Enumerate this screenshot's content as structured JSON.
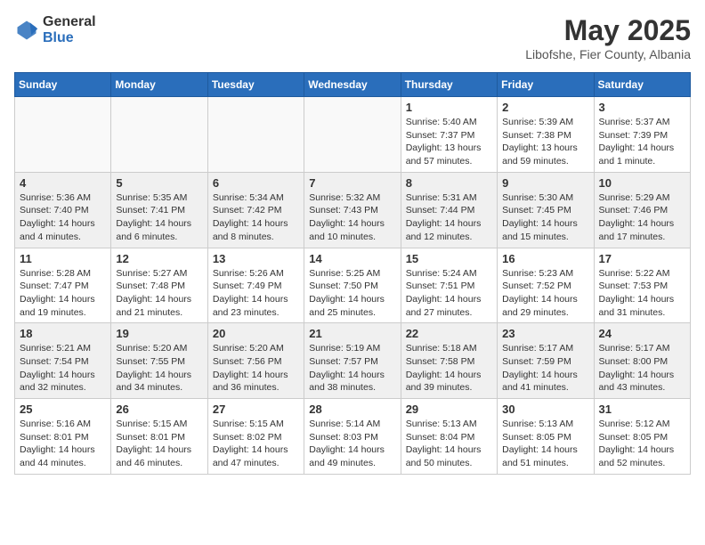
{
  "logo": {
    "general": "General",
    "blue": "Blue"
  },
  "header": {
    "month": "May 2025",
    "location": "Libofshe, Fier County, Albania"
  },
  "weekdays": [
    "Sunday",
    "Monday",
    "Tuesday",
    "Wednesday",
    "Thursday",
    "Friday",
    "Saturday"
  ],
  "weeks": [
    [
      {
        "day": "",
        "info": ""
      },
      {
        "day": "",
        "info": ""
      },
      {
        "day": "",
        "info": ""
      },
      {
        "day": "",
        "info": ""
      },
      {
        "day": "1",
        "info": "Sunrise: 5:40 AM\nSunset: 7:37 PM\nDaylight: 13 hours\nand 57 minutes."
      },
      {
        "day": "2",
        "info": "Sunrise: 5:39 AM\nSunset: 7:38 PM\nDaylight: 13 hours\nand 59 minutes."
      },
      {
        "day": "3",
        "info": "Sunrise: 5:37 AM\nSunset: 7:39 PM\nDaylight: 14 hours\nand 1 minute."
      }
    ],
    [
      {
        "day": "4",
        "info": "Sunrise: 5:36 AM\nSunset: 7:40 PM\nDaylight: 14 hours\nand 4 minutes."
      },
      {
        "day": "5",
        "info": "Sunrise: 5:35 AM\nSunset: 7:41 PM\nDaylight: 14 hours\nand 6 minutes."
      },
      {
        "day": "6",
        "info": "Sunrise: 5:34 AM\nSunset: 7:42 PM\nDaylight: 14 hours\nand 8 minutes."
      },
      {
        "day": "7",
        "info": "Sunrise: 5:32 AM\nSunset: 7:43 PM\nDaylight: 14 hours\nand 10 minutes."
      },
      {
        "day": "8",
        "info": "Sunrise: 5:31 AM\nSunset: 7:44 PM\nDaylight: 14 hours\nand 12 minutes."
      },
      {
        "day": "9",
        "info": "Sunrise: 5:30 AM\nSunset: 7:45 PM\nDaylight: 14 hours\nand 15 minutes."
      },
      {
        "day": "10",
        "info": "Sunrise: 5:29 AM\nSunset: 7:46 PM\nDaylight: 14 hours\nand 17 minutes."
      }
    ],
    [
      {
        "day": "11",
        "info": "Sunrise: 5:28 AM\nSunset: 7:47 PM\nDaylight: 14 hours\nand 19 minutes."
      },
      {
        "day": "12",
        "info": "Sunrise: 5:27 AM\nSunset: 7:48 PM\nDaylight: 14 hours\nand 21 minutes."
      },
      {
        "day": "13",
        "info": "Sunrise: 5:26 AM\nSunset: 7:49 PM\nDaylight: 14 hours\nand 23 minutes."
      },
      {
        "day": "14",
        "info": "Sunrise: 5:25 AM\nSunset: 7:50 PM\nDaylight: 14 hours\nand 25 minutes."
      },
      {
        "day": "15",
        "info": "Sunrise: 5:24 AM\nSunset: 7:51 PM\nDaylight: 14 hours\nand 27 minutes."
      },
      {
        "day": "16",
        "info": "Sunrise: 5:23 AM\nSunset: 7:52 PM\nDaylight: 14 hours\nand 29 minutes."
      },
      {
        "day": "17",
        "info": "Sunrise: 5:22 AM\nSunset: 7:53 PM\nDaylight: 14 hours\nand 31 minutes."
      }
    ],
    [
      {
        "day": "18",
        "info": "Sunrise: 5:21 AM\nSunset: 7:54 PM\nDaylight: 14 hours\nand 32 minutes."
      },
      {
        "day": "19",
        "info": "Sunrise: 5:20 AM\nSunset: 7:55 PM\nDaylight: 14 hours\nand 34 minutes."
      },
      {
        "day": "20",
        "info": "Sunrise: 5:20 AM\nSunset: 7:56 PM\nDaylight: 14 hours\nand 36 minutes."
      },
      {
        "day": "21",
        "info": "Sunrise: 5:19 AM\nSunset: 7:57 PM\nDaylight: 14 hours\nand 38 minutes."
      },
      {
        "day": "22",
        "info": "Sunrise: 5:18 AM\nSunset: 7:58 PM\nDaylight: 14 hours\nand 39 minutes."
      },
      {
        "day": "23",
        "info": "Sunrise: 5:17 AM\nSunset: 7:59 PM\nDaylight: 14 hours\nand 41 minutes."
      },
      {
        "day": "24",
        "info": "Sunrise: 5:17 AM\nSunset: 8:00 PM\nDaylight: 14 hours\nand 43 minutes."
      }
    ],
    [
      {
        "day": "25",
        "info": "Sunrise: 5:16 AM\nSunset: 8:01 PM\nDaylight: 14 hours\nand 44 minutes."
      },
      {
        "day": "26",
        "info": "Sunrise: 5:15 AM\nSunset: 8:01 PM\nDaylight: 14 hours\nand 46 minutes."
      },
      {
        "day": "27",
        "info": "Sunrise: 5:15 AM\nSunset: 8:02 PM\nDaylight: 14 hours\nand 47 minutes."
      },
      {
        "day": "28",
        "info": "Sunrise: 5:14 AM\nSunset: 8:03 PM\nDaylight: 14 hours\nand 49 minutes."
      },
      {
        "day": "29",
        "info": "Sunrise: 5:13 AM\nSunset: 8:04 PM\nDaylight: 14 hours\nand 50 minutes."
      },
      {
        "day": "30",
        "info": "Sunrise: 5:13 AM\nSunset: 8:05 PM\nDaylight: 14 hours\nand 51 minutes."
      },
      {
        "day": "31",
        "info": "Sunrise: 5:12 AM\nSunset: 8:05 PM\nDaylight: 14 hours\nand 52 minutes."
      }
    ]
  ]
}
